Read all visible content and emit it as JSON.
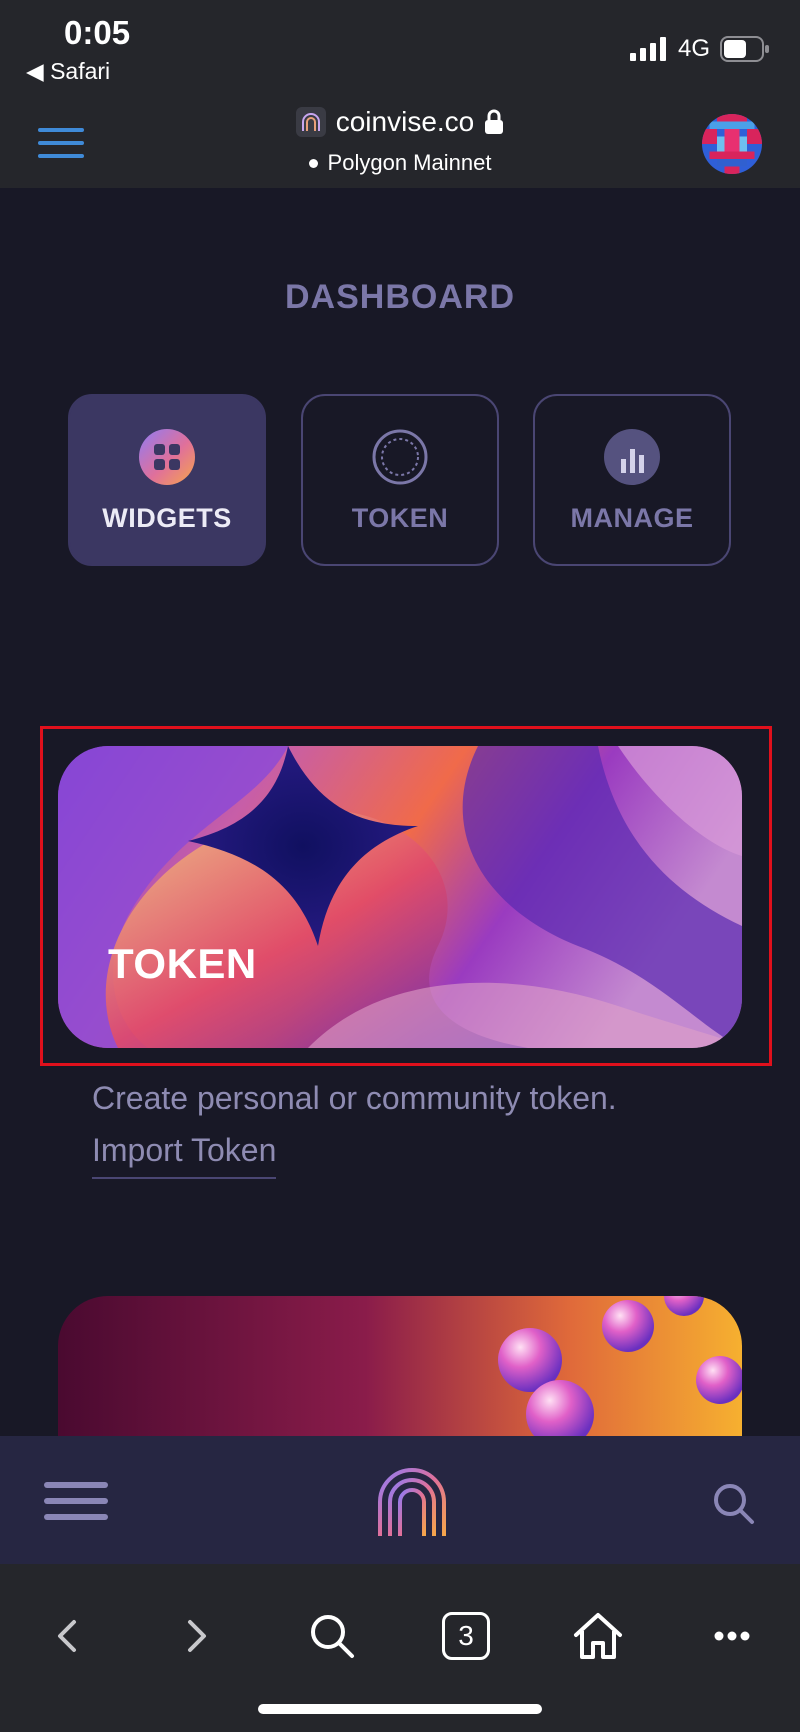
{
  "status_bar": {
    "time": "0:05",
    "back_app": "◀ Safari",
    "network": "4G"
  },
  "browser": {
    "url": "coinvise.co",
    "network_status": "Polygon Mainnet"
  },
  "dashboard": {
    "title": "DASHBOARD",
    "tabs": [
      {
        "label": "WIDGETS",
        "icon": "grid-icon",
        "active": true
      },
      {
        "label": "TOKEN",
        "icon": "coin-icon",
        "active": false
      },
      {
        "label": "MANAGE",
        "icon": "bar-chart-icon",
        "active": false
      }
    ]
  },
  "token_card": {
    "title": "TOKEN",
    "description": "Create personal or community token.",
    "link": "Import Token"
  },
  "app_bar": {
    "menu_icon": "hamburger-icon",
    "logo_icon": "coinvise-logo-icon",
    "search_icon": "search-icon"
  },
  "safari_toolbar": {
    "tabs_count": "3",
    "buttons": [
      "back-icon",
      "forward-icon",
      "search-icon",
      "tabs-icon",
      "home-icon",
      "more-icon"
    ]
  },
  "colors": {
    "background": "#181826",
    "accent": "#7b77a8",
    "highlight_border": "#e0101c",
    "active_tab": "#3b3762"
  }
}
